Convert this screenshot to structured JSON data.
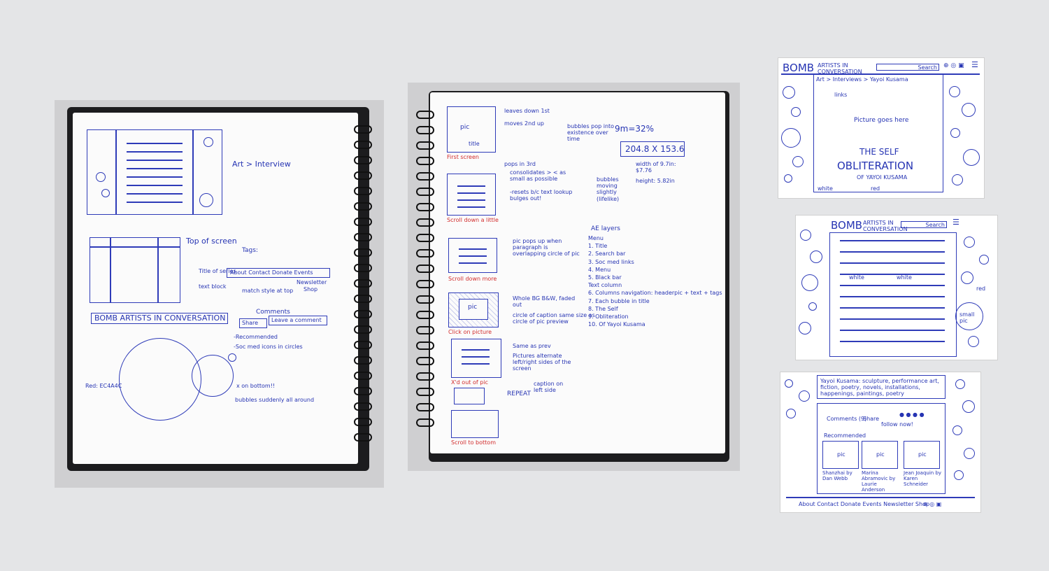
{
  "sketch1": {
    "breadcrumb": "Art > Interview",
    "top_of_screen": "Top of screen",
    "tags": "Tags:",
    "nav_links": "About Contact Donate Events",
    "newsletter": "Newsletter",
    "shop": "Shop",
    "title_of_series": "Title of series",
    "text_block": "text block",
    "match_style": "match style at top",
    "logo_text": "BOMB ARTISTS IN CONVERSATION",
    "comments": "Comments",
    "share": "Share",
    "leave_comment": "Leave a comment",
    "recommended": "-Recommended",
    "soc_med": "-Soc med icons in circles",
    "x_on_bottom": "x on bottom!!",
    "bubbles_all_around": "bubbles suddenly all around",
    "red_color": "Red: EC4A4C"
  },
  "sketch2": {
    "first_screen": "First screen",
    "scroll_down_little": "Scroll down a little",
    "scroll_down_more": "Scroll down more",
    "click_on_picture": "Click on picture",
    "x_out_of_pic": "X'd out of pic",
    "scroll_to_bottom": "Scroll to bottom",
    "pic": "pic",
    "title": "title",
    "leaves_down_1st": "leaves down 1st",
    "moves_2nd_up": "moves 2nd up",
    "pops_in_3rd": "pops in 3rd",
    "bubbles_note": "bubbles pop into existence over time",
    "consolidates": "consolidates > < as small as possible",
    "resets_title": "-resets b/c text lookup bulges out!",
    "bubbles_moving": "bubbles moving slightly (lifelike)",
    "pic_pops_up": "pic pops up when paragraph is overlapping circle of pic",
    "whole_bg": "Whole BG B&W, faded out",
    "circle_caption": "circle of caption same size as circle of pic preview",
    "same_as_prev": "Same as prev",
    "pictures_alternate": "Pictures alternate left/right sides of the screen",
    "repeat": "REPEAT",
    "caption_left": "caption on left side",
    "dim1": "9m=32%",
    "dim2": "204.8 X 153.6",
    "dim3": "width of 9.7in: $7.76",
    "dim4": "height: 5.82in",
    "ae_layers": "AE layers",
    "layers": [
      "Menu",
      "1. Title",
      "2. Search bar",
      "3. Soc med links",
      "4. Menu",
      "5. Black bar",
      "Text column",
      "6. Columns navigation: headerpic + text + tags",
      "7. Each bubble in title",
      "8. The Self",
      "9. Obliteration",
      "10. Of Yayoi Kusama"
    ]
  },
  "mock1": {
    "logo": "BOMB",
    "logo_sub": "ARTISTS IN CONVERSATION",
    "search": "Search",
    "breadcrumb": "Art > Interviews > Yayoi Kusama",
    "links": "links",
    "picture_goes_here": "Picture goes here",
    "the_self": "THE SELF",
    "obliteration": "OBLITERATION",
    "of_yayoi": "OF YAYOI KUSAMA",
    "white": "white",
    "red": "red"
  },
  "mock2": {
    "logo": "BOMB",
    "logo_sub": "ARTISTS IN CONVERSATION",
    "search": "Search",
    "white": "white",
    "red": "red",
    "small_pic": "small pic"
  },
  "mock3": {
    "bio": "Yayoi Kusama: sculpture, performance art, fiction, poetry, novels, installations, happenings, paintings, poetry",
    "comments": "Comments (9)",
    "share": "Share",
    "recommended": "Recommended",
    "follow_now": "follow now!",
    "pic": "pic",
    "cap1": "Shanzhai by Dan Webb",
    "cap2": "Marina Abramovic by Laurie Anderson",
    "cap3": "Jean Joaquin by Karen Schneider",
    "footer": "About Contact Donate Events Newsletter Shop"
  }
}
